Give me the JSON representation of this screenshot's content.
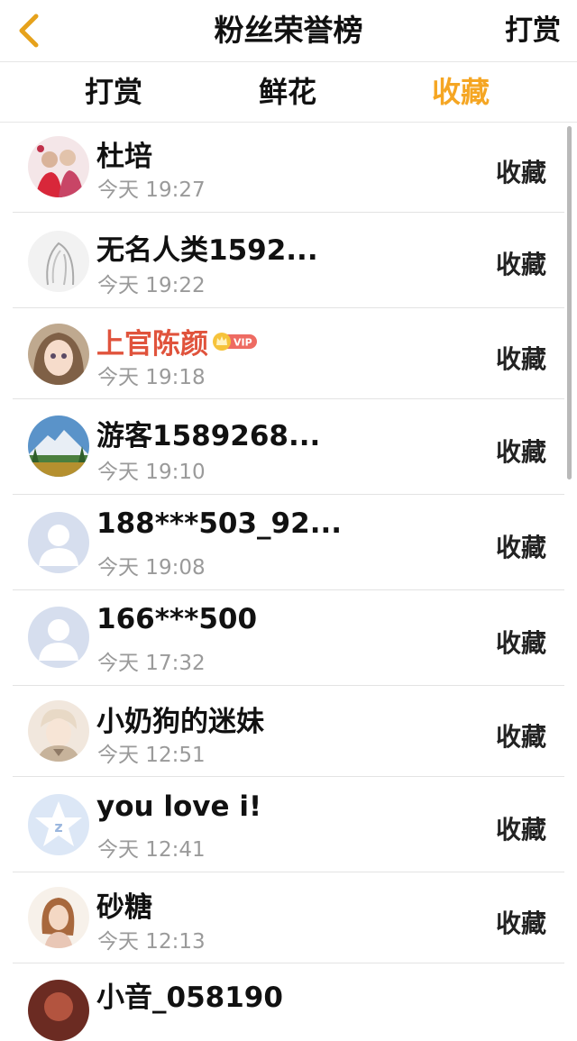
{
  "nav": {
    "title": "粉丝荣誉榜",
    "right_label": "打赏"
  },
  "tabs": [
    {
      "label": "打赏",
      "active": false
    },
    {
      "label": "鲜花",
      "active": false
    },
    {
      "label": "收藏",
      "active": true
    }
  ],
  "colors": {
    "accent": "#f5a623",
    "vip_name": "#e0533c",
    "muted": "#9a9a9a"
  },
  "vip_badge_text": "VIP",
  "rows": [
    {
      "name": "杜培",
      "time": "今天 19:27",
      "action": "收藏",
      "avatar": "photo-avatar-icon",
      "vip": false
    },
    {
      "name": "无名人类1592...",
      "time": "今天 19:22",
      "action": "收藏",
      "avatar": "sketch-avatar-icon",
      "vip": false
    },
    {
      "name": "上官陈颜",
      "time": "今天 19:18",
      "action": "收藏",
      "avatar": "anime-avatar-icon",
      "vip": true
    },
    {
      "name": "游客1589268...",
      "time": "今天 19:10",
      "action": "收藏",
      "avatar": "landscape-avatar-icon",
      "vip": false
    },
    {
      "name": "188***503_92...",
      "time": "今天 19:08",
      "action": "收藏",
      "avatar": "default-avatar-icon",
      "vip": false
    },
    {
      "name": "166***500",
      "time": "今天 17:32",
      "action": "收藏",
      "avatar": "default-avatar-icon",
      "vip": false
    },
    {
      "name": "小奶狗的迷妹",
      "time": "今天 12:51",
      "action": "收藏",
      "avatar": "anime-avatar-icon",
      "vip": false
    },
    {
      "name": "you love i!",
      "time": "今天 12:41",
      "action": "收藏",
      "avatar": "qzone-star-avatar-icon",
      "vip": false
    },
    {
      "name": "砂糖",
      "time": "今天 12:13",
      "action": "收藏",
      "avatar": "portrait-avatar-icon",
      "vip": false
    },
    {
      "name": "小音_058190",
      "time": "",
      "action": "",
      "avatar": "photo-avatar-icon",
      "vip": false
    }
  ]
}
